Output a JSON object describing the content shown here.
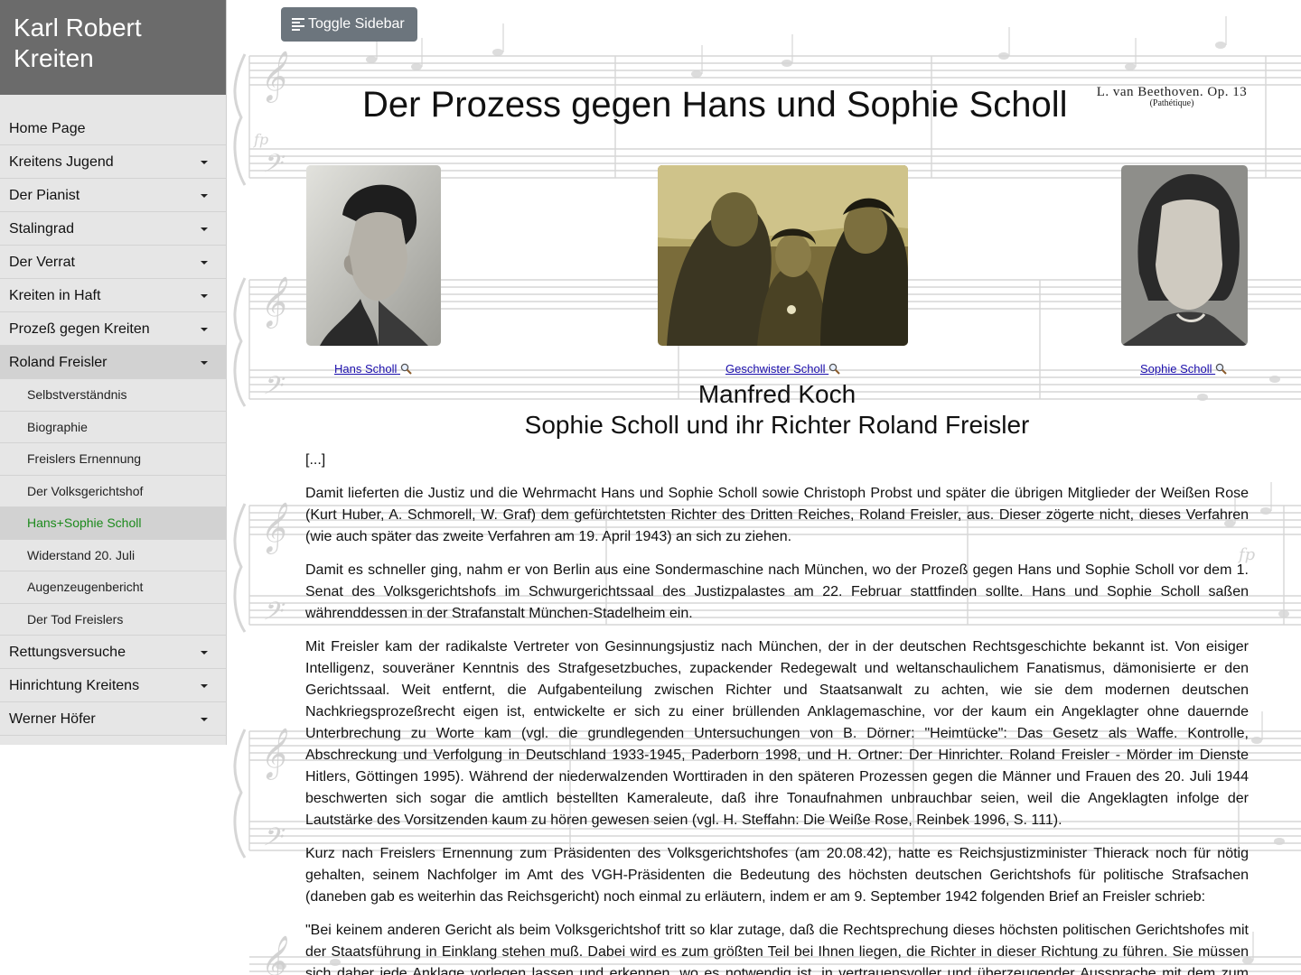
{
  "site": {
    "title": "Karl Robert Kreiten"
  },
  "sidebar": {
    "items": [
      {
        "label": "Home Page",
        "has_caret": false
      },
      {
        "label": "Kreitens Jugend",
        "has_caret": true
      },
      {
        "label": "Der Pianist",
        "has_caret": true
      },
      {
        "label": "Stalingrad",
        "has_caret": true
      },
      {
        "label": "Der Verrat",
        "has_caret": true
      },
      {
        "label": "Kreiten in Haft",
        "has_caret": true
      },
      {
        "label": "Prozeß gegen Kreiten",
        "has_caret": true
      },
      {
        "label": "Roland Freisler",
        "has_caret": true,
        "expanded": true
      }
    ],
    "subitems": [
      {
        "label": "Selbstverständnis"
      },
      {
        "label": "Biographie"
      },
      {
        "label": "Freislers Ernennung"
      },
      {
        "label": "Der Volksgerichtshof"
      },
      {
        "label": "Hans+Sophie Scholl",
        "current": true
      },
      {
        "label": "Widerstand 20. Juli"
      },
      {
        "label": "Augenzeugenbericht"
      },
      {
        "label": "Der Tod Freislers"
      }
    ],
    "items_after": [
      {
        "label": "Rettungsversuche"
      },
      {
        "label": "Hinrichtung Kreitens"
      },
      {
        "label": "Werner Höfer"
      }
    ],
    "colors": {
      "header_bg": "#6b6b6b",
      "menu_bg": "#e6e6e6",
      "current_link": "#1c8a1c"
    }
  },
  "toolbar": {
    "toggle_label": "Toggle Sidebar",
    "toggle_bg": "#6c757d"
  },
  "page": {
    "title": "Der Prozess gegen Hans und Sophie Scholl",
    "score_credit_line1": "L. van Beethoven. Op. 13",
    "score_credit_line2": "(Pathétique)"
  },
  "photos": [
    {
      "caption": "Hans Scholl"
    },
    {
      "caption": "Geschwister Scholl"
    },
    {
      "caption": "Sophie Scholl"
    }
  ],
  "article": {
    "author": "Manfred Koch",
    "heading": "Sophie Scholl und ihr Richter Roland Freisler",
    "paragraphs": [
      "[...]",
      "Damit lieferten die Justiz und die Wehrmacht Hans und Sophie Scholl sowie Christoph Probst und später die übrigen Mitglieder der Weißen Rose (Kurt Huber, A. Schmorell, W. Graf) dem gefürchtetsten Richter des Dritten Reiches, Roland Freisler, aus. Dieser zögerte nicht, dieses Verfahren (wie auch später das zweite Verfahren am 19. April 1943) an sich zu ziehen.",
      "Damit es schneller ging, nahm er von Berlin aus eine Sondermaschine nach München, wo der Prozeß gegen Hans und Sophie Scholl vor dem 1. Senat des Volksgerichtshofs im Schwurgerichtssaal des Justizpalastes am 22. Februar stattfinden sollte. Hans und Sophie Scholl saßen währenddessen in der Strafanstalt München-Stadelheim ein.",
      "Mit Freisler kam der radikalste Vertreter von Gesinnungsjustiz nach München, der in der deutschen Rechtsgeschichte bekannt ist. Von eisiger Intelligenz, souveräner Kenntnis des Strafgesetzbuches, zupackender Redegewalt und weltanschaulichem Fanatismus, dämonisierte er den Gerichtssaal. Weit entfernt, die Aufgabenteilung zwischen Richter und Staatsanwalt zu achten, wie sie dem modernen deutschen Nachkriegsprozeßrecht eigen ist, entwickelte er sich zu einer brüllenden Anklagemaschine, vor der kaum ein Angeklagter ohne dauernde Unterbrechung zu Worte kam (vgl. die grundlegenden Untersuchungen von B. Dörner: \"Heimtücke\": Das Gesetz als Waffe. Kontrolle, Abschreckung und Verfolgung in Deutschland 1933-1945, Paderborn 1998, und H. Ortner: Der Hinrichter. Roland Freisler - Mörder im Dienste Hitlers, Göttingen 1995). Während der niederwalzenden Worttiraden in den späteren Prozessen gegen die Männer und Frauen des 20. Juli 1944 beschwerten sich sogar die amtlich bestellten Kameraleute, daß ihre Tonaufnahmen unbrauchbar seien, weil die Angeklagten infolge der Lautstärke des Vorsitzenden kaum zu hören gewesen seien (vgl. H. Steffahn: Die Weiße Rose, Reinbek 1996, S. 111).",
      "Kurz nach Freislers Ernennung zum Präsidenten des Volksgerichtshofes (am 20.08.42), hatte es Reichsjustizminister Thierack noch für nötig gehalten, seinem Nachfolger im Amt des VGH-Präsidenten die Bedeutung des höchsten deutschen Gerichtshofs für politische Strafsachen (daneben gab es weiterhin das Reichsgericht) noch einmal zu erläutern, indem er am 9. September 1942 folgenden Brief an Freisler schrieb:",
      "\"Bei keinem anderen Gericht als beim Volksgerichtshof tritt so klar zutage, daß die Rechtsprechung dieses höchsten politischen Gerichtshofes mit der Staatsführung in Einklang stehen muß. Dabei wird es zum größten Teil bei Ihnen liegen, die Richter in dieser Richtung zu führen. Sie müssen sich daher jede Anklage vorlegen lassen und erkennen, wo es notwendig ist, in vertrauensvoller und überzeugender Aussprache mit dem zum Richter berufenen Mann das erforderliche Verständnis herbeizuführen."
    ]
  }
}
